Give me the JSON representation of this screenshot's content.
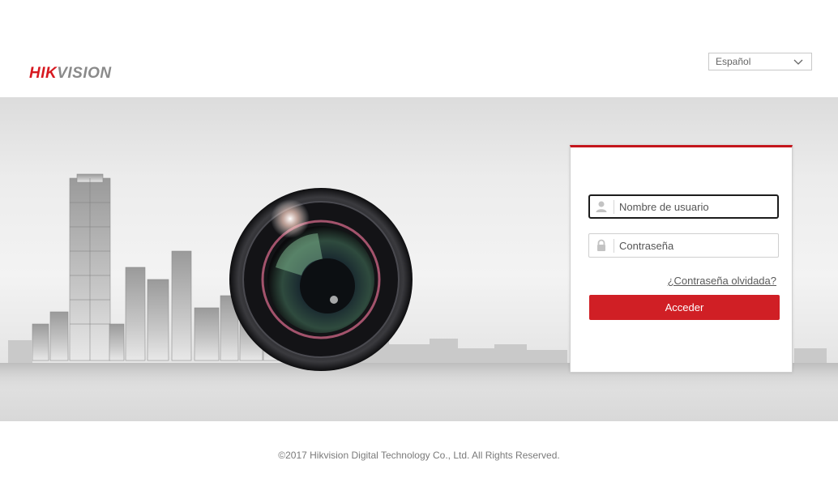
{
  "header": {
    "logo": {
      "hik": "HIK",
      "vision": "VISION"
    },
    "language": {
      "selected": "Español",
      "icon": "chevron-down-icon"
    }
  },
  "login": {
    "username": {
      "placeholder": "Nombre de usuario",
      "value": "",
      "icon": "user-icon"
    },
    "password": {
      "placeholder": "Contraseña",
      "value": "",
      "icon": "lock-icon"
    },
    "forgot_label": "¿Contraseña olvidada?",
    "submit_label": "Acceder"
  },
  "footer": {
    "copyright": "©2017 Hikvision Digital Technology Co., Ltd. All Rights Reserved."
  },
  "colors": {
    "brand_red": "#d01f25",
    "panel_top_border": "#c4161c",
    "logo_grey": "#8a8a8a"
  }
}
